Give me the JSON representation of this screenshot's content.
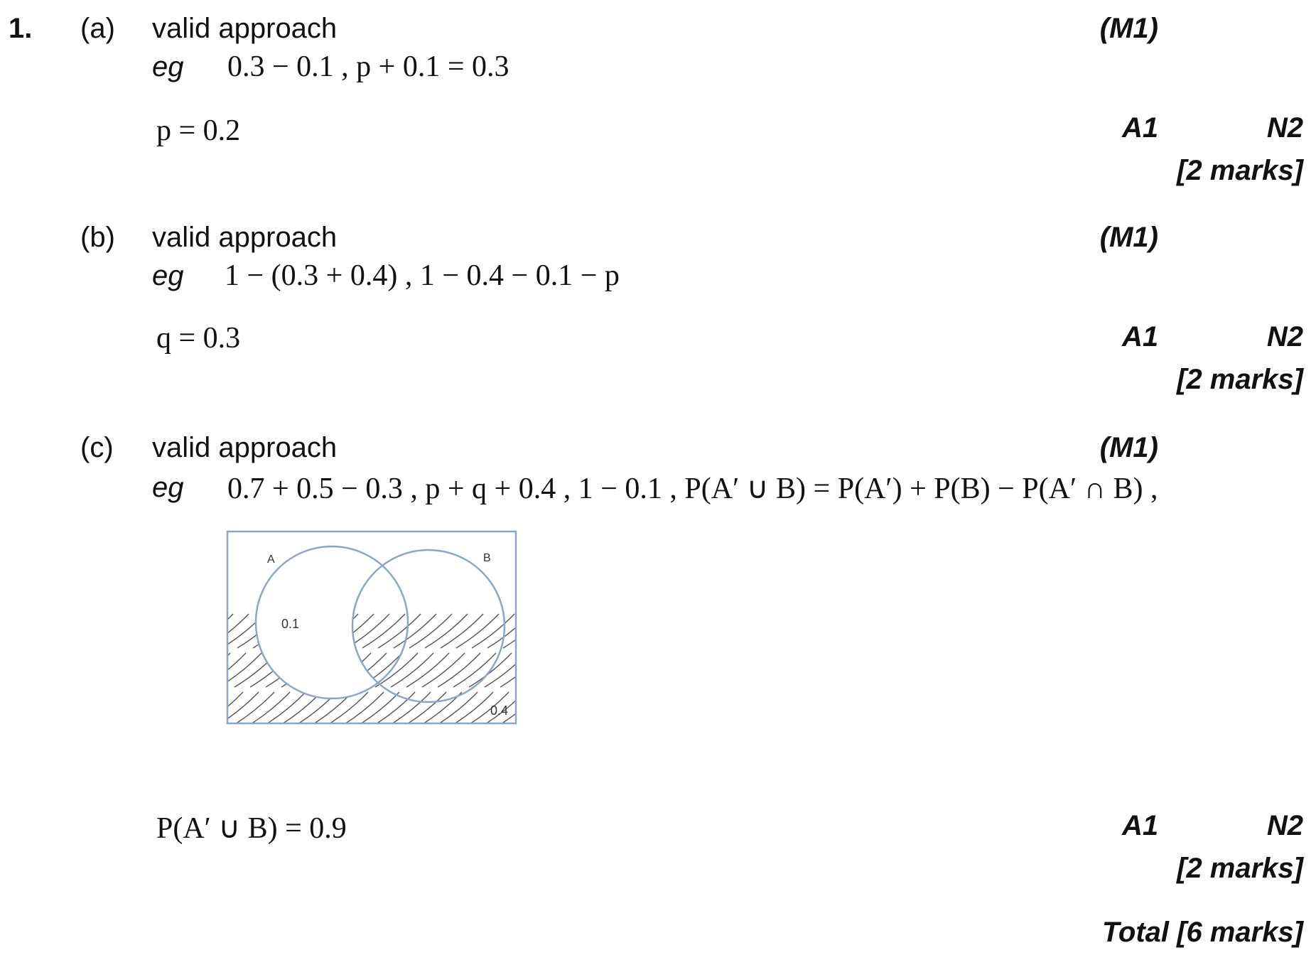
{
  "question_number": "1.",
  "parts": [
    {
      "label": "(a)",
      "approach": "valid approach",
      "eg_label": "eg",
      "eg_expr": "0.3 − 0.1 ,  p + 0.1 = 0.3",
      "method_mark": "(M1)",
      "answer": "p = 0.2",
      "answer_mark": "A1",
      "n_mark": "N2",
      "marks": "[2 marks]"
    },
    {
      "label": "(b)",
      "approach": "valid approach",
      "eg_label": "eg",
      "eg_expr": "1 − (0.3 + 0.4) ,  1 − 0.4 − 0.1 − p",
      "method_mark": "(M1)",
      "answer": "q = 0.3",
      "answer_mark": "A1",
      "n_mark": "N2",
      "marks": "[2 marks]"
    },
    {
      "label": "(c)",
      "approach": "valid approach",
      "eg_label": "eg",
      "eg_expr": "0.7 + 0.5 − 0.3 ,  p + q + 0.4 ,  1 − 0.1 ,  P(A′ ∪ B) = P(A′) + P(B) − P(A′ ∩ B) ,",
      "method_mark": "(M1)",
      "answer": "P(A′ ∪ B) = 0.9",
      "answer_mark": "A1",
      "n_mark": "N2",
      "marks": "[2 marks]",
      "diagram": {
        "label_a": "A",
        "label_b": "B",
        "value_a_only": "0.1",
        "value_outside": "0.4",
        "line_color": "#8aa6c8",
        "hatch_color": "#555555"
      }
    }
  ],
  "total": "Total [6 marks]"
}
